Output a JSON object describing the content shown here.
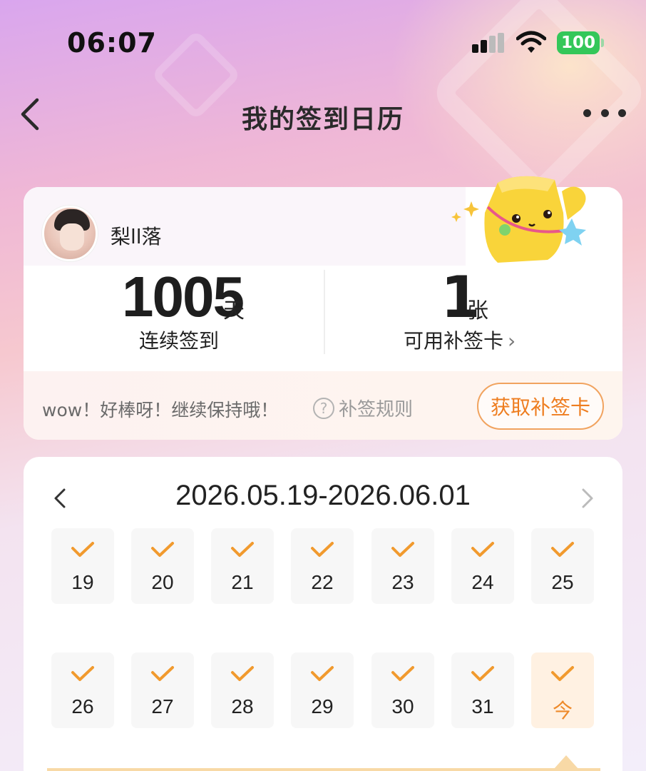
{
  "status": {
    "time": "06:07",
    "battery": "100"
  },
  "nav": {
    "title": "我的签到日历"
  },
  "profile": {
    "username": "梨ll落"
  },
  "stats": {
    "streak_value": "1005",
    "streak_unit": "天",
    "streak_label": "连续签到",
    "cards_value": "1",
    "cards_unit": "张",
    "cards_label": "可用补签卡"
  },
  "banner": {
    "message": "wow！好棒呀！继续保持哦！",
    "rules_label": "补签规则",
    "get_card_button": "获取补签卡"
  },
  "calendar": {
    "range": "2026.05.19-2026.06.01",
    "week1": [
      "19",
      "20",
      "21",
      "22",
      "23",
      "24",
      "25"
    ],
    "week2": [
      "26",
      "27",
      "28",
      "29",
      "30",
      "31",
      "今"
    ]
  },
  "colors": {
    "accent": "#ee7d1f",
    "battery": "#34c759"
  },
  "icons": [
    "chevron-left-icon",
    "more-icon",
    "help-icon",
    "chevron-right-icon",
    "check-icon"
  ]
}
